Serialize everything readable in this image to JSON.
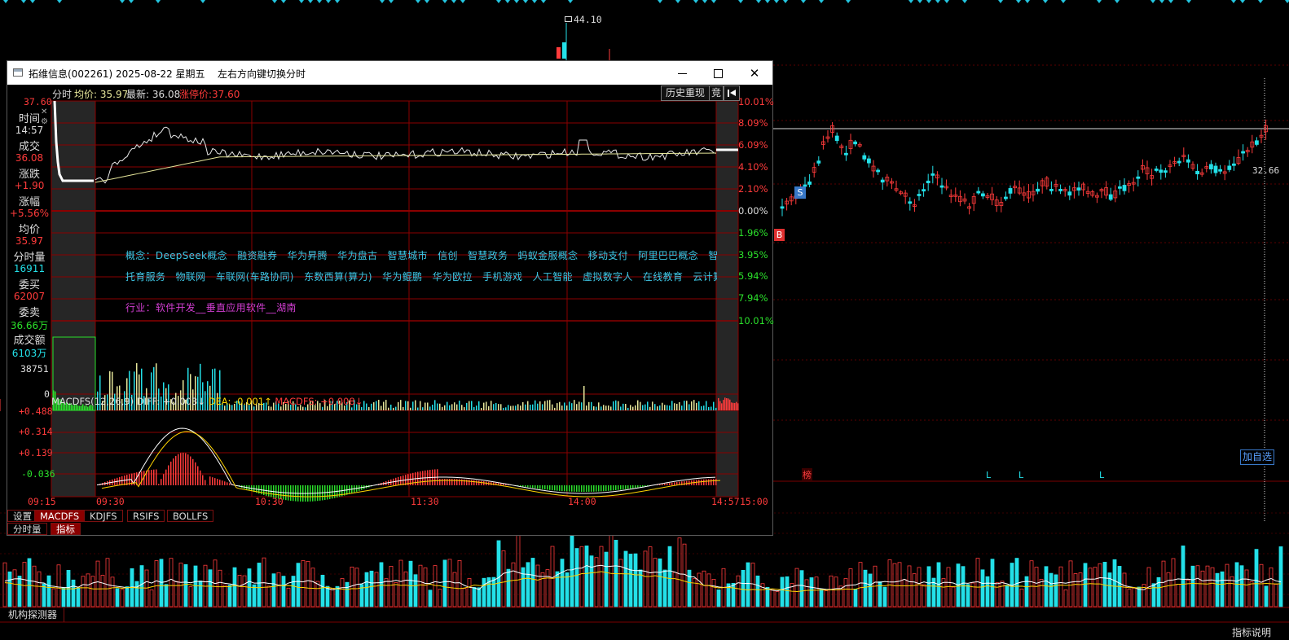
{
  "background_chart": {
    "price_max_label": "44.10",
    "price_right_label": "32.66",
    "badge_s": "S",
    "badge_b": "B",
    "badge_bang": "榜",
    "l_markers": [
      "L",
      "L",
      "L"
    ],
    "add_watch_label": "加自选",
    "bottom_tab": "机构探测器",
    "indicator_help": "指标说明"
  },
  "popup": {
    "title": "拓维信息(002261) 2025-08-22 星期五",
    "hint": "左右方向键切换分时",
    "history_button": "历史重现",
    "auction_button": "竞",
    "info_prefix": "分时",
    "avg_label": "均价: 35.97",
    "latest_label": "最新: 36.08",
    "limit_up_label": "涨停价:37.60",
    "top_price_label": "37.60",
    "left_panel": {
      "time_label": "时间",
      "time_value": "14:57",
      "deal_label": "成交",
      "deal_value": "36.08",
      "change_label": "涨跌",
      "change_value": "+1.90",
      "pct_label": "涨幅",
      "pct_value": "+5.56%",
      "avg_label": "均价",
      "avg_value": "35.97",
      "vol_label": "分时量",
      "vol_value": "16911",
      "bid_label": "委买",
      "bid_value": "62007",
      "ask_label": "委卖",
      "ask_value": "36.66万",
      "amount_label": "成交额",
      "amount_value": "6103万"
    },
    "right_pct_labels": [
      "10.01%",
      "8.09%",
      "6.09%",
      "4.10%",
      "2.10%",
      "0.00%",
      "1.96%",
      "3.95%",
      "5.94%",
      "7.94%",
      "10.01%"
    ],
    "concepts_line1": "概念：DeepSeek概念　融资融券　华为昇腾　华为盘古　智慧城市　信创　智慧政务　蚂蚁金服概念　移动支付　阿里巴巴概念　智能医疗",
    "concepts_line2": "托育服务　物联网　车联网(车路协同)　东数西算(算力)　华为鲲鹏　华为欧拉　手机游戏　人工智能　虚拟数字人　在线教育　云计算　云",
    "industry": "行业：软件开发__垂直应用软件__湖南",
    "volume_max_label": "38751",
    "volume_zero_label": "0",
    "macd": {
      "header_name": "MACDFS(12,26,9)",
      "diff_label": "DIFF: +0.003↓",
      "dea_label": "DEA: -0.001↑",
      "macdfs_label": "MACDFS: +0.008↓",
      "y_labels": [
        "+0.488",
        "+0.314",
        "+0.139",
        "-0.036"
      ]
    },
    "time_axis": [
      "09:15",
      "09:30",
      "10:30",
      "11:30",
      "14:00",
      "14:57",
      "15:00"
    ],
    "tabs": [
      "设置",
      "MACDFS",
      "KDJFS",
      "RSIFS",
      "BOLLFS"
    ],
    "bottom_tabs": [
      "分时量",
      "指标"
    ],
    "colors": {
      "grid": "#8b0000",
      "price_line": "#e8e8e8",
      "avg_line": "#e6e69a",
      "up": "#ff3b3b",
      "down": "#23e0e8",
      "green": "#2be02b",
      "concept": "#3fc7e6",
      "industry": "#d23ed2",
      "yellow": "#ffd400"
    }
  }
}
